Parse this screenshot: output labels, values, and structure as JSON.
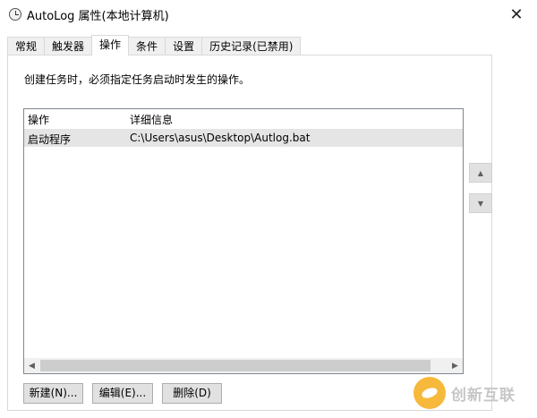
{
  "window": {
    "title": "AutoLog 属性(本地计算机)",
    "close_glyph": "✕"
  },
  "tabs": [
    {
      "label": "常规",
      "active": false
    },
    {
      "label": "触发器",
      "active": false
    },
    {
      "label": "操作",
      "active": true
    },
    {
      "label": "条件",
      "active": false
    },
    {
      "label": "设置",
      "active": false
    },
    {
      "label": "历史记录(已禁用)",
      "active": false
    }
  ],
  "actions_tab": {
    "description": "创建任务时，必须指定任务启动时发生的操作。",
    "list": {
      "columns": [
        "操作",
        "详细信息"
      ],
      "rows": [
        {
          "action": "启动程序",
          "details": "C:\\Users\\asus\\Desktop\\Autlog.bat",
          "selected": true
        }
      ]
    },
    "move_up_glyph": "▲",
    "move_down_glyph": "▼",
    "scroll_left_glyph": "◀",
    "scroll_right_glyph": "▶",
    "buttons": {
      "new": "新建(N)...",
      "edit": "编辑(E)...",
      "delete": "删除(D)"
    }
  },
  "watermark": {
    "text": "创新互联",
    "accent": "#f6b93b"
  },
  "colors": {
    "selected_row": "#e5e5e5",
    "button_face": "#e1e1e1",
    "border": "#d9d9d9"
  }
}
